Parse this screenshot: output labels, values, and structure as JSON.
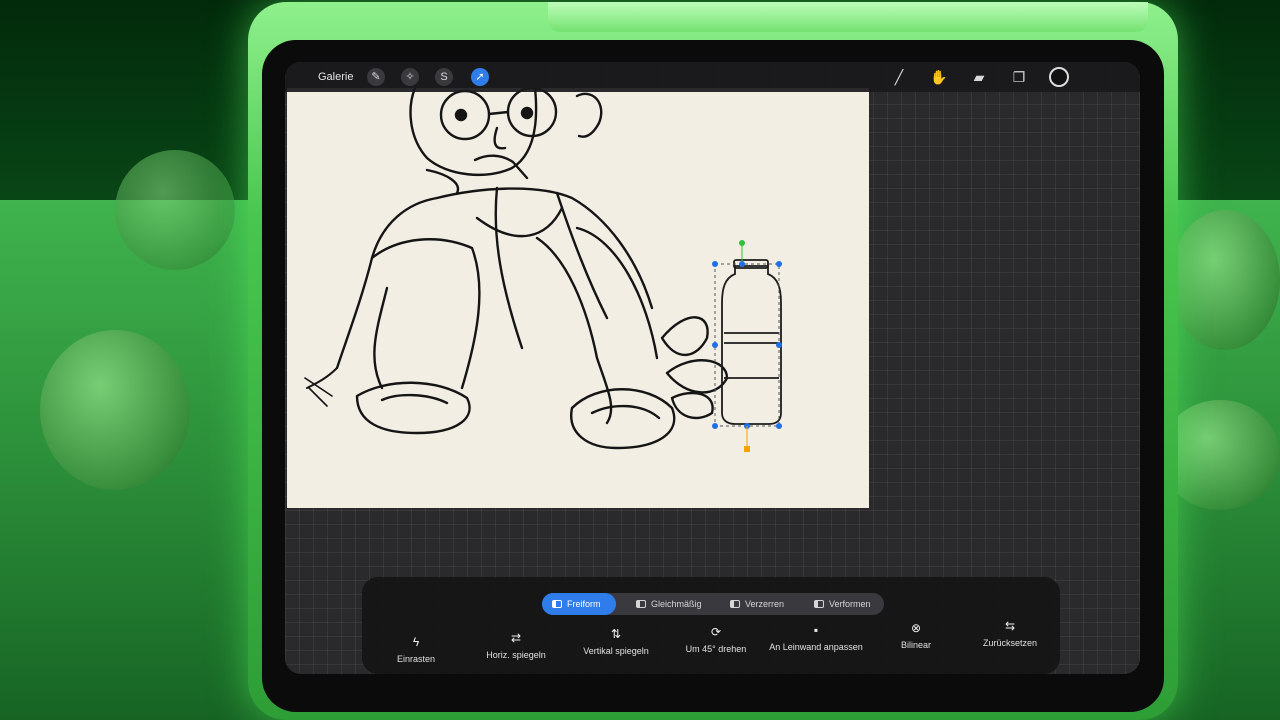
{
  "toolbar": {
    "gallery_label": "Galerie",
    "left_icons": [
      "wrench-icon",
      "magic-wand-icon",
      "selection-icon",
      "transform-arrow-icon"
    ],
    "right_icons": [
      "brush-icon",
      "smudge-icon",
      "eraser-icon",
      "layers-icon",
      "color-icon"
    ]
  },
  "transform": {
    "modes": [
      {
        "label": "Freiform",
        "active": true
      },
      {
        "label": "Gleichmäßig",
        "active": false
      },
      {
        "label": "Verzerren",
        "active": false
      },
      {
        "label": "Verformen",
        "active": false
      }
    ],
    "actions": {
      "snap": "Einrasten",
      "flip_h": "Horiz. spiegeln",
      "flip_v": "Vertikal spiegeln",
      "rotate": "Um 45° drehen",
      "fit": "An Leinwand anpassen",
      "interp": "Bilinear",
      "reset": "Zurücksetzen"
    }
  },
  "colors": {
    "accent": "#2f7dea",
    "selection_handle": "#1f6fe6",
    "rotation_handle": "#2ec13a",
    "pivot_handle": "#f0a400"
  }
}
